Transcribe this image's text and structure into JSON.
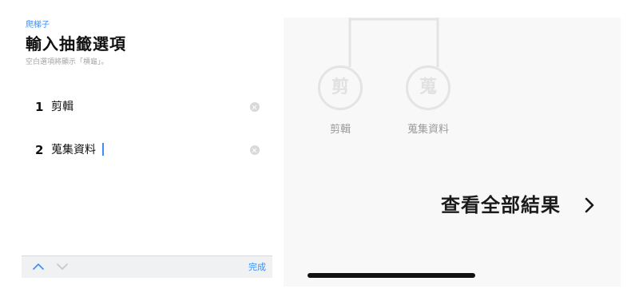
{
  "left": {
    "app_name": "爬梯子",
    "title": "輸入抽籤選項",
    "hint": "空白選項將顯示「槓龜」。",
    "options": [
      {
        "number": "1",
        "value": "剪輯"
      },
      {
        "number": "2",
        "value": "蒐集資料"
      }
    ],
    "toolbar": {
      "up_icon": "chevron-up-icon",
      "down_icon": "chevron-down-icon",
      "done_label": "完成"
    }
  },
  "right": {
    "nodes": [
      {
        "char": "剪",
        "label": "剪輯"
      },
      {
        "char": "蒐",
        "label": "蒐集資料"
      }
    ],
    "view_all_label": "查看全部結果",
    "view_all_icon": "chevron-right-icon"
  },
  "colors": {
    "accent": "#3b8ff7",
    "node_border": "#e4e4e4",
    "label_gray": "#9b9b9b",
    "toolbar_bg": "#f0f1f3"
  }
}
